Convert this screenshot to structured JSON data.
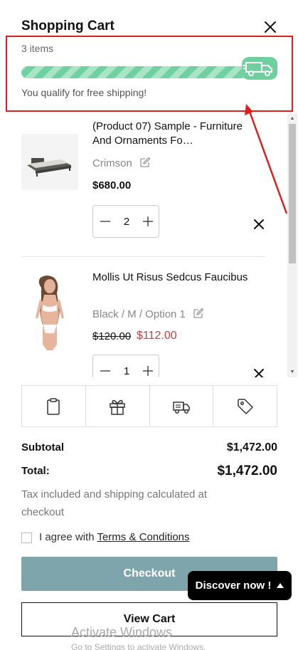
{
  "header": {
    "title": "Shopping Cart",
    "close_icon": "close-icon"
  },
  "shipping": {
    "items_count": "3 items",
    "progress_percent": 100,
    "message": "You qualify for free shipping!",
    "truck_icon": "delivery-truck-icon"
  },
  "items": [
    {
      "name": "(Product 07) Sample - Furniture And Ornaments Fo…",
      "variant": "Crimson",
      "price": "$680.00",
      "quantity": "2"
    },
    {
      "name": "Mollis Ut Risus Sedcus Faucibus",
      "variant": "Black / M / Option 1",
      "compare_price": "$120.00",
      "price": "$112.00",
      "quantity": "1"
    }
  ],
  "actions": [
    {
      "icon": "clipboard-note-icon"
    },
    {
      "icon": "gift-icon"
    },
    {
      "icon": "shipping-truck-icon"
    },
    {
      "icon": "discount-tag-icon"
    }
  ],
  "summary": {
    "subtotal_label": "Subtotal",
    "subtotal_value": "$1,472.00",
    "total_label": "Total:",
    "total_value": "$1,472.00",
    "tax_note": "Tax included and shipping calculated at checkout"
  },
  "agree": {
    "prefix": "I agree with",
    "terms_link": "Terms & Conditions"
  },
  "buttons": {
    "checkout": "Checkout",
    "view_cart": "View Cart",
    "discover": "Discover now !"
  },
  "watermark": {
    "title": "Activate Windows",
    "subtitle": "Go to Settings to activate Windows."
  },
  "colors": {
    "annotation": "#e01e1e",
    "progress": "#6fd0a0",
    "checkout": "#7fa5ac",
    "sale": "#d23b3b"
  }
}
